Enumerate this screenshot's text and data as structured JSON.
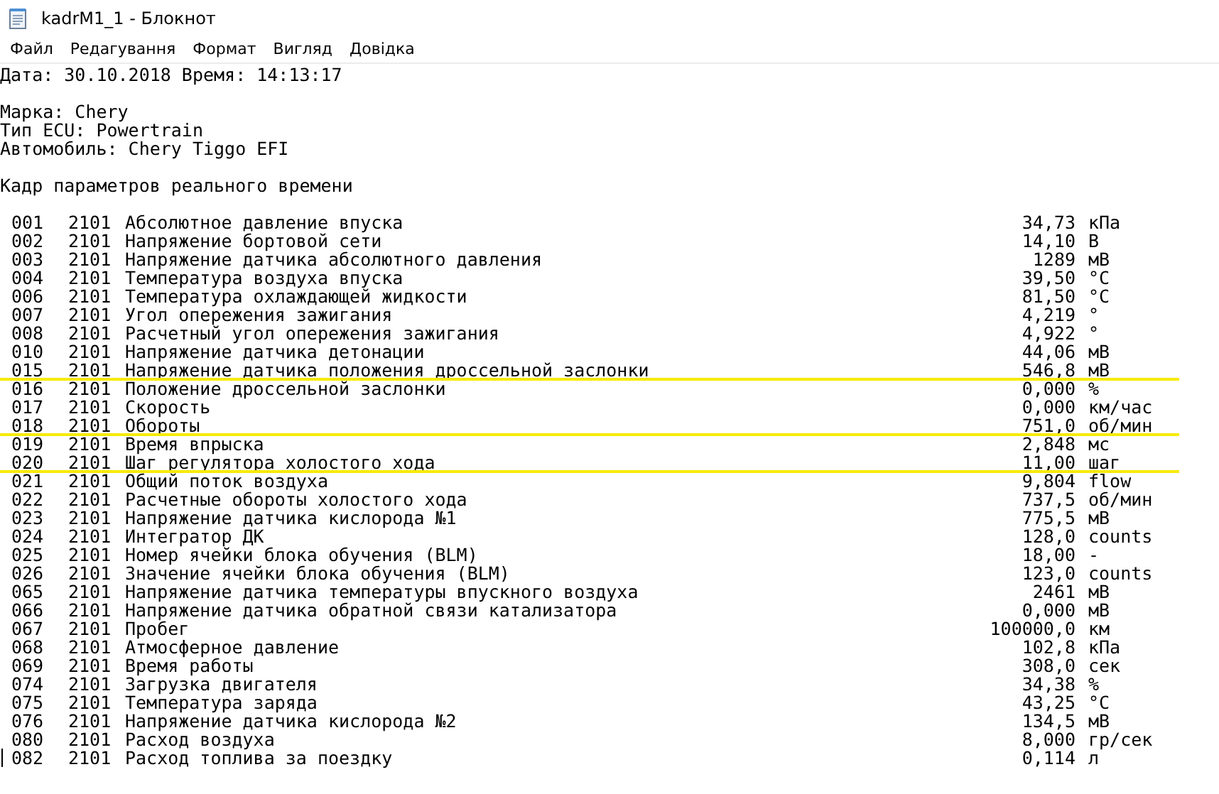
{
  "window": {
    "title": "kadrM1_1 - Блокнот"
  },
  "menu": [
    "Файл",
    "Редагування",
    "Формат",
    "Вигляд",
    "Довідка"
  ],
  "document": {
    "date_line": "Дата: 30.10.2018 Время: 14:13:17",
    "info_lines": [
      "Марка: Chery",
      "Тип ECU: Powertrain",
      "Автомобиль: Chery Tiggo EFI"
    ],
    "section_title": "Кадр параметров реального времени",
    "rows": [
      {
        "no": "001",
        "column_2": "2101",
        "name": "Абсолютное давление впуска",
        "value": "34,73",
        "unit": "кПа",
        "underlined": false
      },
      {
        "no": "002",
        "column_2": "2101",
        "name": "Напряжение бортовой сети",
        "value": "14,10",
        "unit": "В",
        "underlined": false
      },
      {
        "no": "003",
        "column_2": "2101",
        "name": "Напряжение датчика абсолютного давления",
        "value": "1289",
        "unit": "мВ",
        "underlined": false
      },
      {
        "no": "004",
        "column_2": "2101",
        "name": "Температура воздуха впуска",
        "value": "39,50",
        "unit": "°C",
        "underlined": false
      },
      {
        "no": "006",
        "column_2": "2101",
        "name": "Температура охлаждающей жидкости",
        "value": "81,50",
        "unit": "°C",
        "underlined": false
      },
      {
        "no": "007",
        "column_2": "2101",
        "name": "Угол опережения зажигания",
        "value": "4,219",
        "unit": "°",
        "underlined": false
      },
      {
        "no": "008",
        "column_2": "2101",
        "name": "Расчетный угол опережения зажигания",
        "value": "4,922",
        "unit": "°",
        "underlined": false
      },
      {
        "no": "010",
        "column_2": "2101",
        "name": "Напряжение датчика детонации",
        "value": "44,06",
        "unit": "мВ",
        "underlined": false
      },
      {
        "no": "015",
        "column_2": "2101",
        "name": "Напряжение датчика положения дроссельной заслонки",
        "value": "546,8",
        "unit": "мВ",
        "underlined": true
      },
      {
        "no": "016",
        "column_2": "2101",
        "name": "Положение дроссельной заслонки",
        "value": "0,000",
        "unit": "%",
        "underlined": false
      },
      {
        "no": "017",
        "column_2": "2101",
        "name": "Скорость",
        "value": "0,000",
        "unit": "км/час",
        "underlined": false
      },
      {
        "no": "018",
        "column_2": "2101",
        "name": "Обороты",
        "value": "751,0",
        "unit": "об/мин",
        "underlined": true
      },
      {
        "no": "019",
        "column_2": "2101",
        "name": "Время впрыска",
        "value": "2,848",
        "unit": "мс",
        "underlined": false
      },
      {
        "no": "020",
        "column_2": "2101",
        "name": "Шаг регулятора холостого хода",
        "value": "11,00",
        "unit": "шаг",
        "underlined": true
      },
      {
        "no": "021",
        "column_2": "2101",
        "name": "Общий поток воздуха",
        "value": "9,804",
        "unit": "flow",
        "underlined": false
      },
      {
        "no": "022",
        "column_2": "2101",
        "name": "Расчетные обороты холостого хода",
        "value": "737,5",
        "unit": "об/мин",
        "underlined": false
      },
      {
        "no": "023",
        "column_2": "2101",
        "name": "Напряжение датчика кислорода №1",
        "value": "775,5",
        "unit": "мВ",
        "underlined": false
      },
      {
        "no": "024",
        "column_2": "2101",
        "name": "Интегратор ДК",
        "value": "128,0",
        "unit": "counts",
        "underlined": false
      },
      {
        "no": "025",
        "column_2": "2101",
        "name": "Номер ячейки блока обучения (BLM)",
        "value": "18,00",
        "unit": "-",
        "underlined": false
      },
      {
        "no": "026",
        "column_2": "2101",
        "name": "Значение ячейки блока обучения (BLM)",
        "value": "123,0",
        "unit": "counts",
        "underlined": false
      },
      {
        "no": "065",
        "column_2": "2101",
        "name": "Напряжение датчика температуры впускного воздуха",
        "value": "2461",
        "unit": "мВ",
        "underlined": false
      },
      {
        "no": "066",
        "column_2": "2101",
        "name": "Напряжение датчика обратной связи катализатора",
        "value": "0,000",
        "unit": "мВ",
        "underlined": false
      },
      {
        "no": "067",
        "column_2": "2101",
        "name": "Пробег",
        "value": "100000,0",
        "unit": "км",
        "underlined": false
      },
      {
        "no": "068",
        "column_2": "2101",
        "name": "Атмосферное давление",
        "value": "102,8",
        "unit": "кПа",
        "underlined": false
      },
      {
        "no": "069",
        "column_2": "2101",
        "name": "Время работы",
        "value": "308,0",
        "unit": "сек",
        "underlined": false
      },
      {
        "no": "074",
        "column_2": "2101",
        "name": "Загрузка двигателя",
        "value": "34,38",
        "unit": "%",
        "underlined": false
      },
      {
        "no": "075",
        "column_2": "2101",
        "name": "Температура заряда",
        "value": "43,25",
        "unit": "°C",
        "underlined": false
      },
      {
        "no": "076",
        "column_2": "2101",
        "name": "Напряжение датчика кислорода №2",
        "value": "134,5",
        "unit": "мВ",
        "underlined": false
      },
      {
        "no": "080",
        "column_2": "2101",
        "name": "Расход воздуха",
        "value": "8,000",
        "unit": "гр/сек",
        "underlined": false
      },
      {
        "no": "082",
        "column_2": "2101",
        "name": "Расход топлива за поездку",
        "value": "0,114",
        "unit": "л",
        "underlined": false
      }
    ]
  }
}
